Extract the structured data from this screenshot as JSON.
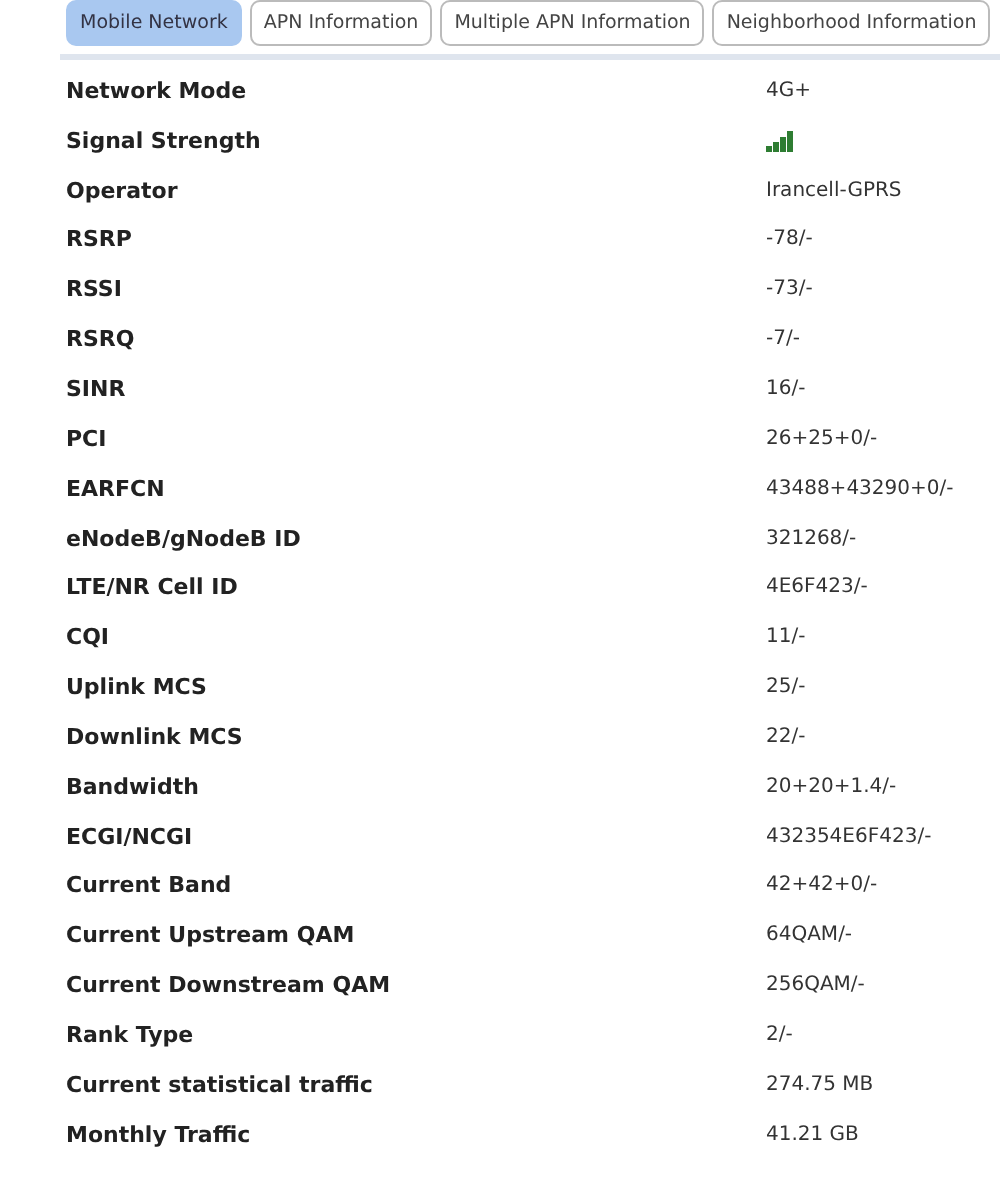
{
  "tabs": [
    {
      "label": "Mobile Network",
      "selected": true
    },
    {
      "label": "APN Information",
      "selected": false
    },
    {
      "label": "Multiple APN Information",
      "selected": false
    },
    {
      "label": "Neighborhood Information",
      "selected": false
    }
  ],
  "rows": [
    {
      "kind": "text",
      "label": "Network Mode",
      "value": "4G+"
    },
    {
      "kind": "signal",
      "label": "Signal Strength"
    },
    {
      "kind": "text",
      "label": "Operator",
      "value": "Irancell-GPRS"
    },
    {
      "kind": "text",
      "label": "RSRP",
      "value": "-78/-"
    },
    {
      "kind": "text",
      "label": "RSSI",
      "value": "-73/-"
    },
    {
      "kind": "text",
      "label": "RSRQ",
      "value": "-7/-"
    },
    {
      "kind": "text",
      "label": "SINR",
      "value": "16/-"
    },
    {
      "kind": "text",
      "label": "PCI",
      "value": "26+25+0/-"
    },
    {
      "kind": "text",
      "label": "EARFCN",
      "value": "43488+43290+0/-"
    },
    {
      "kind": "text",
      "label": "eNodeB/gNodeB ID",
      "value": "321268/-"
    },
    {
      "kind": "text",
      "label": "LTE/NR Cell ID",
      "value": "4E6F423/-"
    },
    {
      "kind": "text",
      "label": "CQI",
      "value": "11/-"
    },
    {
      "kind": "text",
      "label": "Uplink MCS",
      "value": "25/-"
    },
    {
      "kind": "text",
      "label": "Downlink MCS",
      "value": "22/-"
    },
    {
      "kind": "text",
      "label": "Bandwidth",
      "value": "20+20+1.4/-"
    },
    {
      "kind": "text",
      "label": "ECGI/NCGI",
      "value": "432354E6F423/-"
    },
    {
      "kind": "text",
      "label": "Current Band",
      "value": "42+42+0/-"
    },
    {
      "kind": "text",
      "label": "Current Upstream QAM",
      "value": "64QAM/-"
    },
    {
      "kind": "text",
      "label": "Current Downstream QAM",
      "value": "256QAM/-"
    },
    {
      "kind": "text",
      "label": "Rank Type",
      "value": "2/-"
    },
    {
      "kind": "text",
      "label": "Current statistical traffic",
      "value": "274.75 MB"
    },
    {
      "kind": "text",
      "label": "Monthly Traffic",
      "value": "41.21 GB"
    }
  ]
}
